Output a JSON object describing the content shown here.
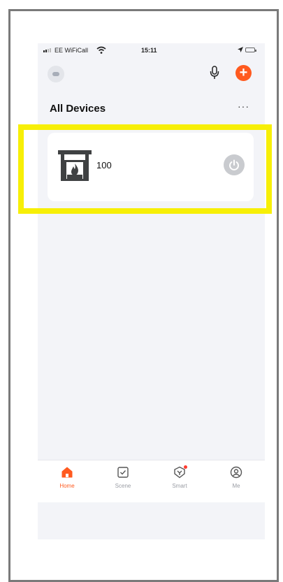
{
  "status_bar": {
    "carrier": "EE WiFiCall",
    "time": "15:11"
  },
  "header": {
    "title": "All Devices",
    "more_label": "···"
  },
  "devices": [
    {
      "name": "100",
      "icon": "fireplace-icon",
      "power": "off"
    }
  ],
  "tabs": [
    {
      "label": "Home",
      "icon": "home-icon",
      "active": true
    },
    {
      "label": "Scene",
      "icon": "scene-icon",
      "active": false
    },
    {
      "label": "Smart",
      "icon": "smart-icon",
      "active": false
    },
    {
      "label": "Me",
      "icon": "me-icon",
      "active": false
    }
  ],
  "colors": {
    "accent": "#ff5a1f",
    "highlight": "#f7ef07",
    "background": "#f3f4f8"
  }
}
